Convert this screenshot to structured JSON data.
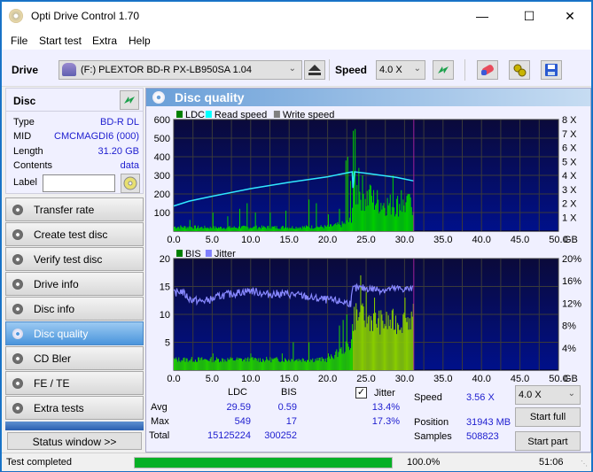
{
  "window": {
    "title": "Opti Drive Control 1.70",
    "controls": {
      "minimize": "—",
      "maximize": "☐",
      "close": "✕"
    }
  },
  "menu": [
    "File",
    "Start test",
    "Extra",
    "Help"
  ],
  "toolbar": {
    "drive_label": "Drive",
    "drive_value": "(F:)   PLEXTOR BD-R  PX-LB950SA 1.04",
    "speed_label": "Speed",
    "speed_value": "4.0 X",
    "icons": [
      "eject-icon",
      "refresh-icon",
      "erase-icon",
      "settings-icon",
      "save-icon"
    ]
  },
  "disc": {
    "header": "Disc",
    "type_label": "Type",
    "type_value": "BD-R DL",
    "mid_label": "MID",
    "mid_value": "CMCMAGDI6 (000)",
    "length_label": "Length",
    "length_value": "31.20 GB",
    "contents_label": "Contents",
    "contents_value": "data",
    "label_label": "Label",
    "label_value": ""
  },
  "nav": [
    {
      "label": "Transfer rate",
      "active": false
    },
    {
      "label": "Create test disc",
      "active": false
    },
    {
      "label": "Verify test disc",
      "active": false
    },
    {
      "label": "Drive info",
      "active": false
    },
    {
      "label": "Disc info",
      "active": false
    },
    {
      "label": "Disc quality",
      "active": true
    },
    {
      "label": "CD Bler",
      "active": false
    },
    {
      "label": "FE / TE",
      "active": false
    },
    {
      "label": "Extra tests",
      "active": false
    }
  ],
  "status_window_button": "Status window >>",
  "panel_title": "Disc quality",
  "chart_data": [
    {
      "type": "bar",
      "title": "LDC / Read speed",
      "legend": [
        "LDC",
        "Read speed",
        "Write speed"
      ],
      "legend_colors": [
        "#008000",
        "#00ffff",
        "#808080"
      ],
      "legend_placement": "top-left",
      "xlabel": "GB",
      "xlim": [
        0,
        50
      ],
      "x_ticks": [
        "0.0",
        "5.0",
        "10.0",
        "15.0",
        "20.0",
        "25.0",
        "30.0",
        "35.0",
        "40.0",
        "45.0",
        "50.0"
      ],
      "ylim": [
        0,
        600
      ],
      "y_ticks": [
        "100",
        "200",
        "300",
        "400",
        "500",
        "600"
      ],
      "y2lim": [
        0,
        8
      ],
      "y2_ticks": [
        "1 X",
        "2 X",
        "3 X",
        "4 X",
        "5 X",
        "6 X",
        "7 X",
        "8 X"
      ],
      "end_marker_gb": 31.2,
      "ldc_baseline": [
        [
          0,
          25
        ],
        [
          5,
          20
        ],
        [
          10,
          22
        ],
        [
          15,
          22
        ],
        [
          20,
          25
        ],
        [
          22,
          40
        ],
        [
          23,
          60
        ],
        [
          23.3,
          230
        ],
        [
          24,
          220
        ],
        [
          25,
          200
        ],
        [
          26,
          175
        ],
        [
          27,
          160
        ],
        [
          28,
          150
        ],
        [
          29,
          150
        ],
        [
          30,
          145
        ],
        [
          31.2,
          150
        ]
      ],
      "ldc_spikes": [
        [
          0.3,
          150
        ],
        [
          2,
          60
        ],
        [
          5,
          100
        ],
        [
          7,
          80
        ],
        [
          8.5,
          120
        ],
        [
          9.5,
          150
        ],
        [
          10.5,
          100
        ],
        [
          12.5,
          100
        ],
        [
          14.5,
          110
        ],
        [
          17.5,
          170
        ],
        [
          18.5,
          150
        ],
        [
          20,
          90
        ],
        [
          21.5,
          120
        ],
        [
          22.3,
          380
        ],
        [
          22.6,
          400
        ],
        [
          22.9,
          270
        ],
        [
          23.3,
          540
        ],
        [
          23.5,
          549
        ],
        [
          24,
          340
        ],
        [
          24.5,
          300
        ],
        [
          25.5,
          250
        ],
        [
          28.5,
          300
        ],
        [
          29.5,
          220
        ],
        [
          30.5,
          200
        ]
      ],
      "read_speed": [
        [
          0,
          1.8
        ],
        [
          2,
          2.15
        ],
        [
          5,
          2.5
        ],
        [
          10,
          3.05
        ],
        [
          15,
          3.5
        ],
        [
          20,
          3.9
        ],
        [
          23.2,
          4.25
        ],
        [
          23.3,
          3.1
        ],
        [
          23.5,
          4.25
        ],
        [
          25,
          4.15
        ],
        [
          27,
          4.0
        ],
        [
          29,
          3.85
        ],
        [
          31.2,
          3.6
        ]
      ]
    },
    {
      "type": "bar",
      "title": "BIS / Jitter",
      "legend": [
        "BIS",
        "Jitter"
      ],
      "legend_colors": [
        "#008000",
        "#8080ff"
      ],
      "legend_placement": "top-left",
      "xlabel": "GB",
      "xlim": [
        0,
        50
      ],
      "x_ticks": [
        "0.0",
        "5.0",
        "10.0",
        "15.0",
        "20.0",
        "25.0",
        "30.0",
        "35.0",
        "40.0",
        "45.0",
        "50.0"
      ],
      "ylim": [
        0,
        20
      ],
      "y_ticks": [
        "5",
        "10",
        "15",
        "20"
      ],
      "y2lim": [
        0,
        20
      ],
      "y2_ticks": [
        "4%",
        "8%",
        "12%",
        "16%",
        "20%"
      ],
      "end_marker_gb": 31.2,
      "bis_baseline": [
        [
          0,
          2
        ],
        [
          20,
          2
        ],
        [
          21,
          3
        ],
        [
          22,
          4
        ],
        [
          23,
          5
        ],
        [
          23.3,
          10
        ],
        [
          25,
          10
        ],
        [
          27,
          9
        ],
        [
          29,
          9
        ],
        [
          31.2,
          10
        ]
      ],
      "bis_spikes": [
        [
          0.3,
          3
        ],
        [
          5,
          3
        ],
        [
          10,
          3
        ],
        [
          14,
          3
        ],
        [
          15.5,
          5
        ],
        [
          17.5,
          5
        ],
        [
          20,
          3
        ],
        [
          21.5,
          8
        ],
        [
          22,
          9
        ],
        [
          22.5,
          10
        ],
        [
          23.7,
          12
        ],
        [
          24.3,
          17
        ],
        [
          25,
          14
        ],
        [
          26,
          13
        ],
        [
          28.5,
          11
        ],
        [
          30,
          13
        ]
      ],
      "jitter": [
        [
          0,
          13.8
        ],
        [
          1,
          14.2
        ],
        [
          2,
          12.8
        ],
        [
          3.5,
          12.3
        ],
        [
          5,
          12.7
        ],
        [
          6,
          13.3
        ],
        [
          8,
          13.8
        ],
        [
          10,
          14.3
        ],
        [
          12,
          13.6
        ],
        [
          14,
          13.7
        ],
        [
          16,
          13.5
        ],
        [
          18,
          12.9
        ],
        [
          20,
          12.6
        ],
        [
          22,
          12.2
        ],
        [
          23,
          12.0
        ],
        [
          23.3,
          14.6
        ],
        [
          25,
          14.7
        ],
        [
          27,
          14.4
        ],
        [
          29,
          14.6
        ],
        [
          31.2,
          14.5
        ]
      ]
    }
  ],
  "stats": {
    "col_ldc": "LDC",
    "col_bis": "BIS",
    "col_jitter": "Jitter",
    "jitter_checked": true,
    "avg_label": "Avg",
    "avg_ldc": "29.59",
    "avg_bis": "0.59",
    "avg_jitter": "13.4%",
    "max_label": "Max",
    "max_ldc": "549",
    "max_bis": "17",
    "max_jitter": "17.3%",
    "total_label": "Total",
    "total_ldc": "15125224",
    "total_bis": "300252",
    "speed_label": "Speed",
    "speed_value": "3.56 X",
    "position_label": "Position",
    "position_value": "31943 MB",
    "samples_label": "Samples",
    "samples_value": "508823",
    "speed_select": "4.0 X",
    "start_full": "Start full",
    "start_part": "Start part"
  },
  "statusbar": {
    "text": "Test completed",
    "progress_percent": 100,
    "progress_text": "100.0%",
    "time": "51:06"
  }
}
